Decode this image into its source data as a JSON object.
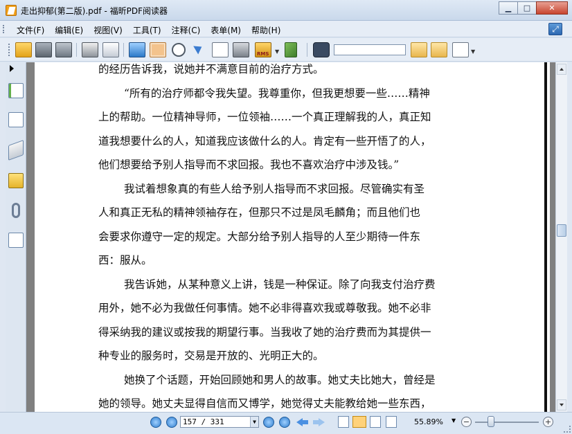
{
  "window": {
    "title": "走出抑郁(第二版).pdf - 福昕PDF阅读器",
    "minimize_label": "▁",
    "maximize_label": "□",
    "close_label": "✕"
  },
  "menu": {
    "items": [
      {
        "label": "文件(F)"
      },
      {
        "label": "编辑(E)"
      },
      {
        "label": "视图(V)"
      },
      {
        "label": "工具(T)"
      },
      {
        "label": "注释(C)"
      },
      {
        "label": "表单(M)"
      },
      {
        "label": "帮助(H)"
      }
    ]
  },
  "toolbar": {
    "icons": [
      "open-folder-icon",
      "save-icon",
      "save-as-icon",
      "print-icon",
      "scan-icon",
      "fullscreen-icon",
      "hand-tool-icon",
      "zoom-icon",
      "select-arrow-icon",
      "text-select-icon",
      "snapshot-icon",
      "rms-lock-icon",
      "sign-pen-icon",
      "find-binoculars-icon",
      "find-prev-icon",
      "find-next-icon",
      "find-options-icon"
    ],
    "rms_label": "RMS",
    "search_value": ""
  },
  "document": {
    "lines": [
      {
        "text": "的经历告诉我，说她并不满意目前的治疗方式。",
        "indent": false
      },
      {
        "text": "“所有的治疗师都令我失望。我尊重你，但我更想要一些……精神",
        "indent": true
      },
      {
        "text": "上的帮助。一位精神导师，一位领袖……一个真正理解我的人，真正知",
        "indent": false
      },
      {
        "text": "道我想要什么的人，知道我应该做什么的人。肯定有一些开悟了的人，",
        "indent": false
      },
      {
        "text": "他们想要给予别人指导而不求回报。我也不喜欢治疗中涉及钱。”",
        "indent": false
      },
      {
        "text": "我试着想象真的有些人给予别人指导而不求回报。尽管确实有圣",
        "indent": true
      },
      {
        "text": "人和真正无私的精神领袖存在，但那只不过是凤毛麟角；而且他们也",
        "indent": false
      },
      {
        "text": "会要求你遵守一定的规定。大部分给予别人指导的人至少期待一件东",
        "indent": false
      },
      {
        "text": "西：服从。",
        "indent": false
      },
      {
        "text": "我告诉她，从某种意义上讲，钱是一种保证。除了向我支付治疗费",
        "indent": true
      },
      {
        "text": "用外，她不必为我做任何事情。她不必非得喜欢我或尊敬我。她不必非",
        "indent": false
      },
      {
        "text": "得采纳我的建议或按我的期望行事。当我收了她的治疗费而为其提供一",
        "indent": false
      },
      {
        "text": "种专业的服务时，交易是开放的、光明正大的。",
        "indent": false
      },
      {
        "text": "她换了个话题，开始回顾她和男人的故事。她丈夫比她大，曾经是",
        "indent": true
      },
      {
        "text": "她的领导。她丈夫显得自信而又博学，她觉得丈夫能教给她一些东西，",
        "indent": false
      }
    ]
  },
  "statusbar": {
    "page_indicator": "157 / 331",
    "zoom": "55.89%",
    "zoom_minus": "−",
    "zoom_plus": "+",
    "zoom_slider_fraction": 0.22
  }
}
